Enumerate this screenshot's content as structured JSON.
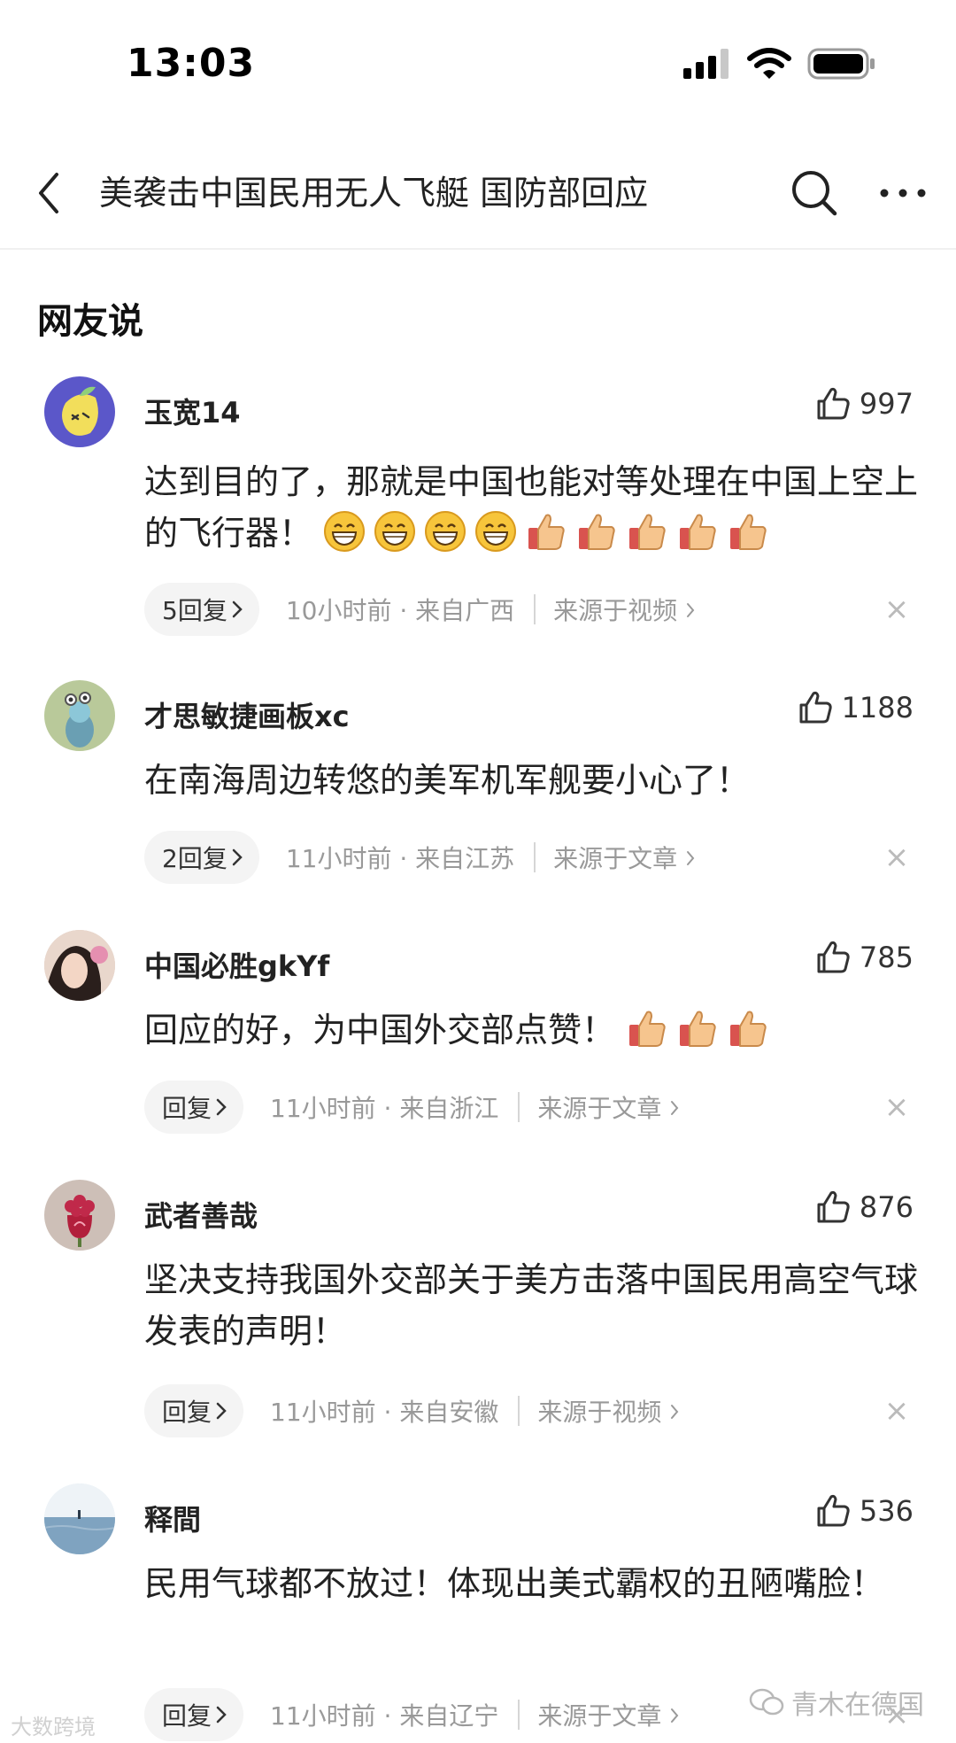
{
  "status_bar": {
    "time": "13:03"
  },
  "nav": {
    "title": "美袭击中国民用无人飞艇 国防部回应"
  },
  "section_title": "网友说",
  "icons": {
    "back": "back-arrow-icon",
    "search": "search-icon",
    "more": "more-icon",
    "like": "thumbs-up-icon",
    "chevron": "chevron-right-icon",
    "close": "close-icon"
  },
  "colors": {
    "meta_text": "#999999",
    "reply_bg": "#f4f4f4",
    "text": "#222222"
  },
  "comments": [
    {
      "username": "玉宽14",
      "likes": "997",
      "content": "达到目的了，那就是中国也能对等处理在中国上空上的飞行器！",
      "emojis": [
        "grin",
        "grin",
        "grin",
        "grin",
        "thumbs-up",
        "thumbs-up",
        "thumbs-up",
        "thumbs-up",
        "thumbs-up"
      ],
      "reply_label": "5回复",
      "meta": "10小时前 · 来自广西",
      "source": "来源于视频",
      "close": "×"
    },
    {
      "username": "才思敏捷画板xc",
      "likes": "1188",
      "content": "在南海周边转悠的美军机军舰要小心了！",
      "emojis": [],
      "reply_label": "2回复",
      "meta": "11小时前 · 来自江苏",
      "source": "来源于文章",
      "close": "×"
    },
    {
      "username": "中国必胜gkYf",
      "likes": "785",
      "content": "回应的好，为中国外交部点赞！",
      "emojis": [
        "thumbs-up",
        "thumbs-up",
        "thumbs-up"
      ],
      "reply_label": "回复",
      "meta": "11小时前 · 来自浙江",
      "source": "来源于文章",
      "close": "×"
    },
    {
      "username": "武者善哉",
      "likes": "876",
      "content": "坚决支持我国外交部关于美方击落中国民用高空气球发表的声明！",
      "emojis": [],
      "reply_label": "回复",
      "meta": "11小时前 · 来自安徽",
      "source": "来源于视频",
      "close": "×"
    },
    {
      "username": "释間",
      "likes": "536",
      "content": "民用气球都不放过！体现出美式霸权的丑陋嘴脸！",
      "emojis": [],
      "reply_label": "回复",
      "meta": "11小时前 · 来自辽宁",
      "source": "来源于文章",
      "close": "×"
    }
  ],
  "watermarks": {
    "left": "大数跨境",
    "right": "青木在德国"
  }
}
